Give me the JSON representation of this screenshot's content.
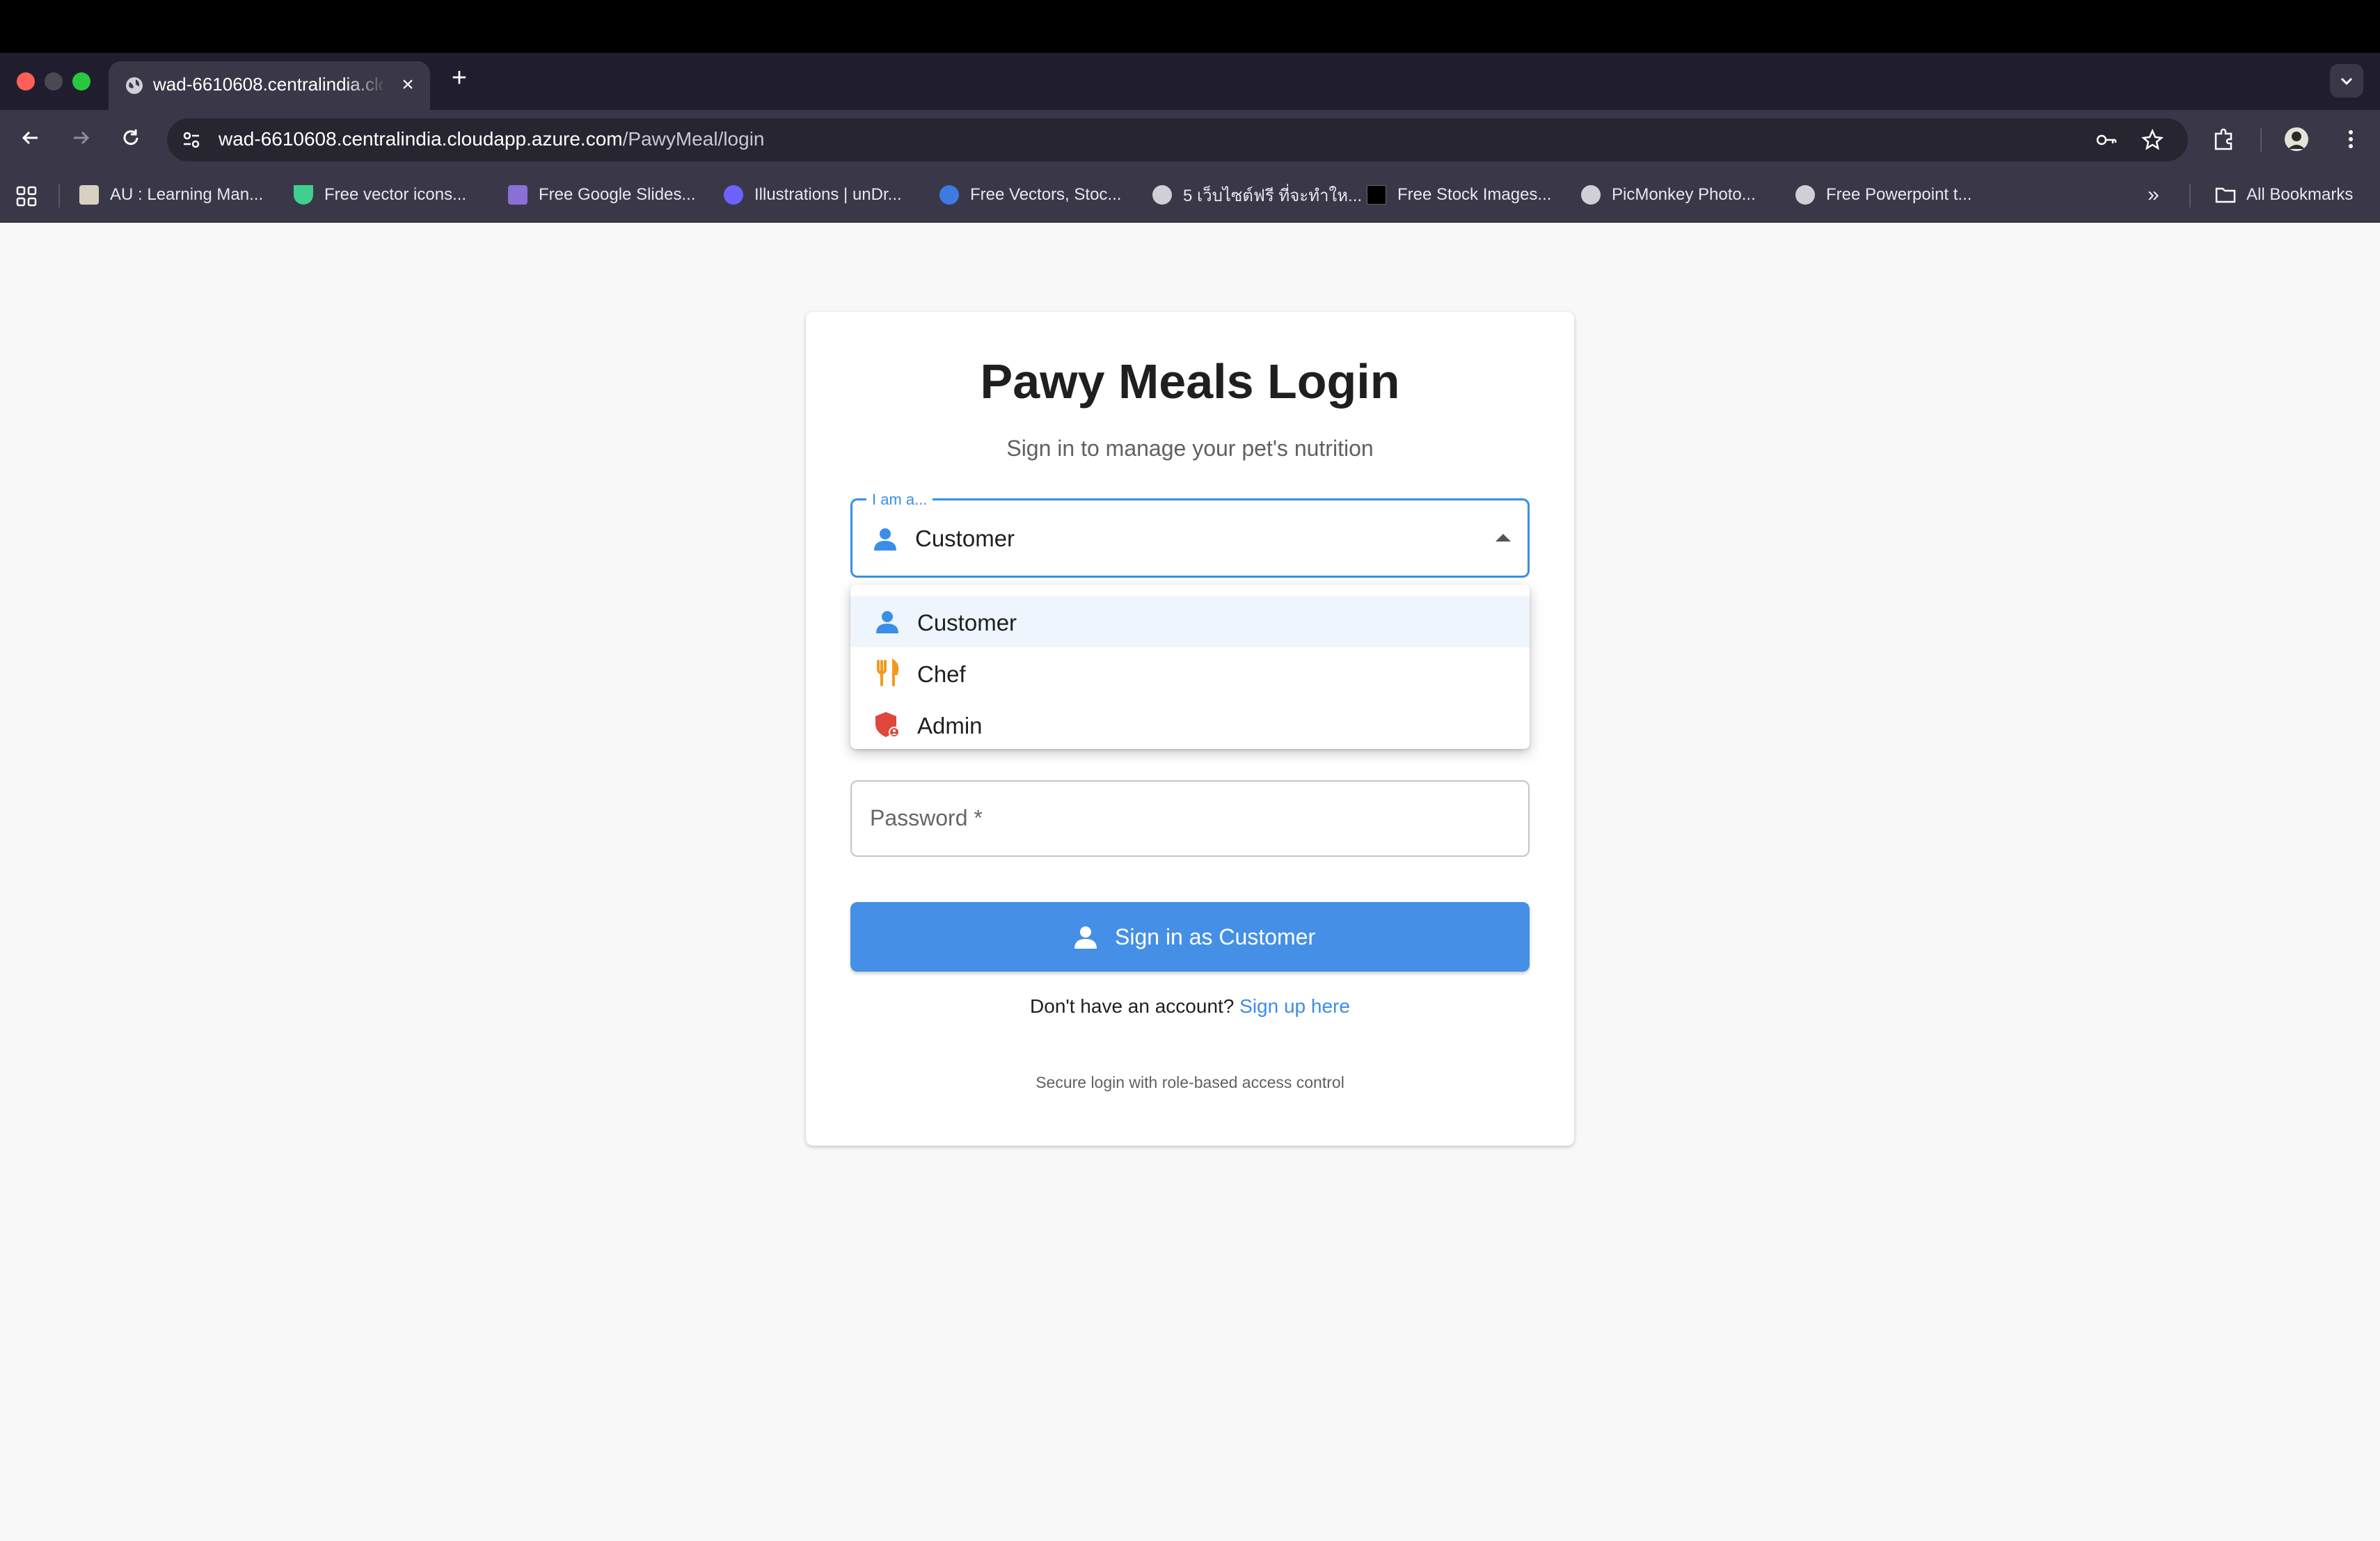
{
  "browser": {
    "tab_title": "wad-6610608.centralindia.cloudapp.azure.com",
    "tab_close": "×",
    "new_tab": "+",
    "url_host": "wad-6610608.centralindia.cloudapp.azure.com",
    "url_path": "/PawyMeal/login",
    "bookmarks": [
      {
        "label": "AU : Learning Man...",
        "icon": "au-favicon",
        "color": "#d8d0c0"
      },
      {
        "label": "Free vector icons...",
        "icon": "vector-favicon",
        "color": "#3fcf8e"
      },
      {
        "label": "Free Google Slides...",
        "icon": "slides-favicon",
        "color": "#8a6fd6"
      },
      {
        "label": "Illustrations | unDr...",
        "icon": "undraw-favicon",
        "color": "#6c63ff"
      },
      {
        "label": "Free Vectors, Stoc...",
        "icon": "vecteezy-favicon",
        "color": "#3d7be0"
      },
      {
        "label": "5 เว็บไซต์ฟรี ที่จะทำให...",
        "icon": "globe-favicon",
        "color": "#cfcfd6"
      },
      {
        "label": "Free Stock Images...",
        "icon": "stock-favicon",
        "color": "#000000"
      },
      {
        "label": "PicMonkey Photo...",
        "icon": "globe-favicon",
        "color": "#cfcfd6"
      },
      {
        "label": "Free Powerpoint t...",
        "icon": "globe-favicon",
        "color": "#cfcfd6"
      }
    ],
    "more_bookmarks": "»",
    "all_bookmarks": "All Bookmarks"
  },
  "login": {
    "title": "Pawy Meals Login",
    "subtitle": "Sign in to manage your pet's nutrition",
    "role_select": {
      "legend": "I am a...",
      "value": "Customer",
      "options": [
        {
          "label": "Customer",
          "icon": "person-icon",
          "color": "#3b8ee6"
        },
        {
          "label": "Chef",
          "icon": "fork-knife-icon",
          "color": "#f29a1f"
        },
        {
          "label": "Admin",
          "icon": "admin-shield-icon",
          "color": "#e0473b"
        }
      ]
    },
    "password_label": "Password *",
    "signin_label": "Sign in as Customer",
    "signup_prompt": "Don't have an account?",
    "signup_link": "Sign up here",
    "footer_note": "Secure login with role-based access control"
  },
  "colors": {
    "accent": "#3b8ee6",
    "button": "#4590e6",
    "page_bg": "#f8f8f8"
  }
}
